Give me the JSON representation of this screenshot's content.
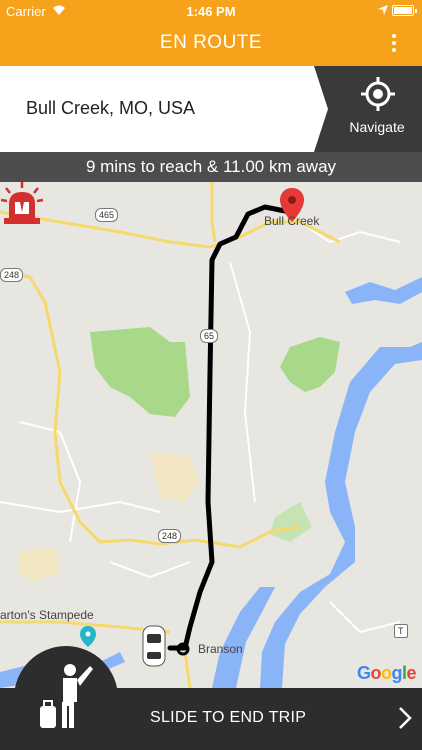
{
  "status_bar": {
    "carrier": "Carrier",
    "time": "1:46 PM"
  },
  "header": {
    "title": "EN ROUTE",
    "menu_icon": "more-vertical-icon"
  },
  "address": {
    "text": "Bull Creek, MO, USA"
  },
  "navigate": {
    "label": "Navigate",
    "icon": "crosshair-icon"
  },
  "trip_info": {
    "text": "9 mins to reach & 11.00 km away"
  },
  "map": {
    "labels": {
      "destination": "Bull Creek",
      "city": "Branson",
      "poi": "arton's Stampede"
    },
    "shields": {
      "route_465": "465",
      "route_248_left": "248",
      "route_65": "65",
      "route_248": "248",
      "route_t": "T"
    },
    "attribution": [
      "G",
      "o",
      "o",
      "g",
      "l",
      "e"
    ],
    "colors": {
      "route": "#000000",
      "water": "#8ab4f8",
      "park": "#a8d98a",
      "road_major": "#f6d96b",
      "pin": "#e53935"
    }
  },
  "slider": {
    "label": "SLIDE TO END TRIP"
  },
  "colors": {
    "accent": "#f7a21b",
    "dark": "#2d2d2d"
  }
}
